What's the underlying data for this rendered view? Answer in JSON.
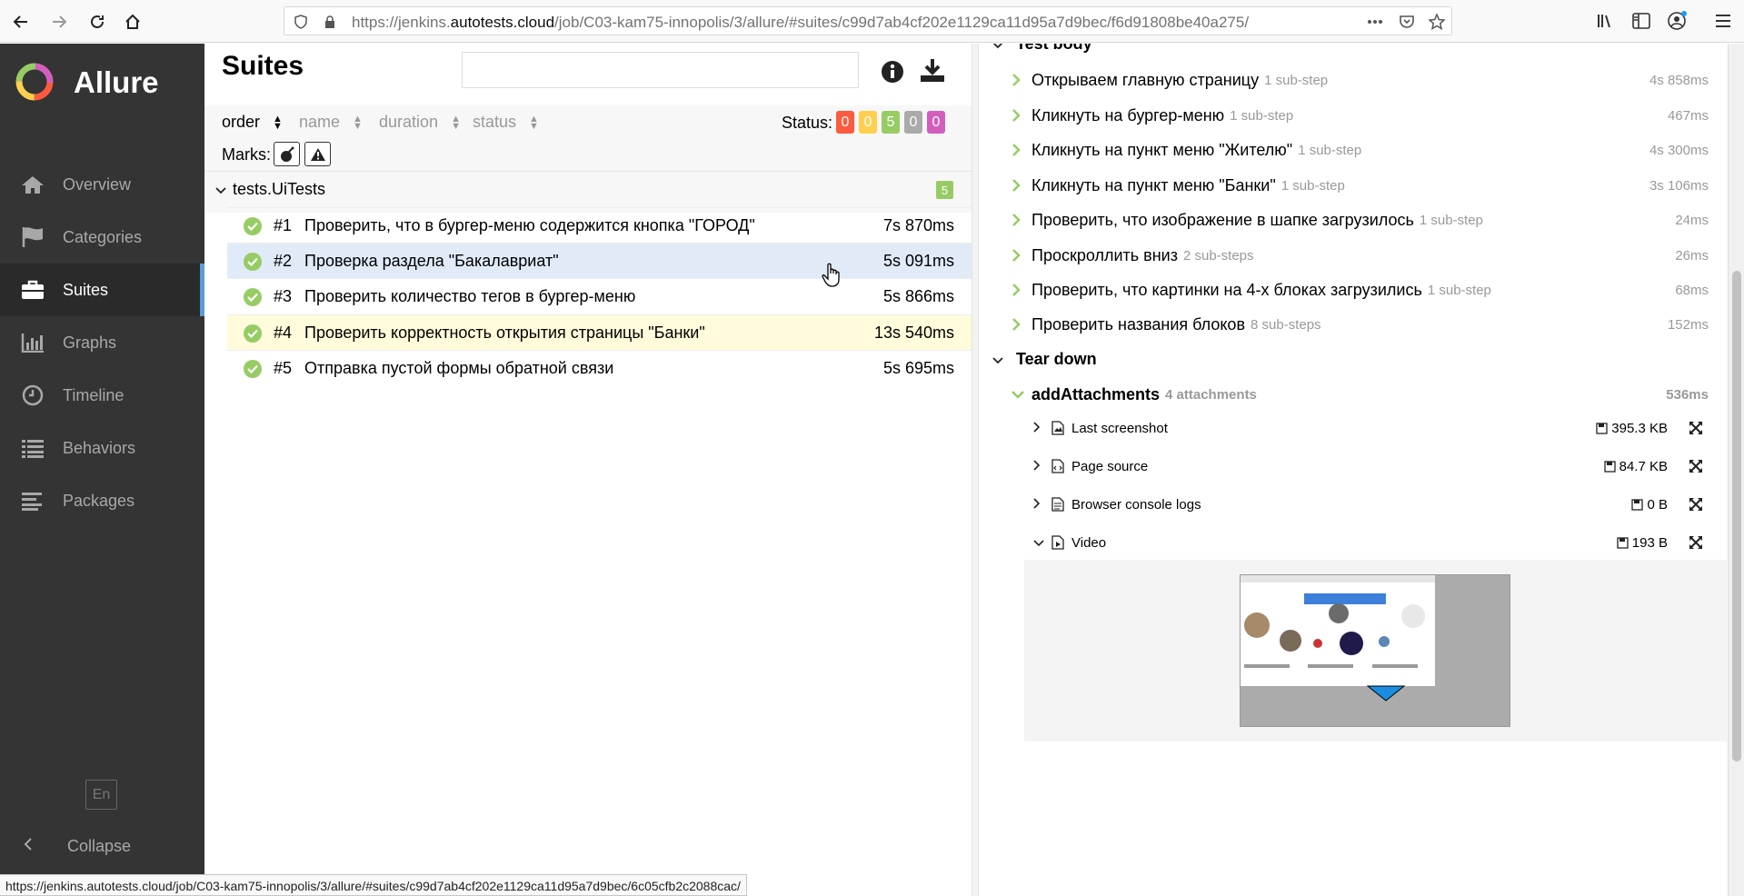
{
  "browser": {
    "url_prefix": "https://jenkins.",
    "url_host": "autotests.cloud",
    "url_path": "/job/C03-kam75-innopolis/3/allure/#suites/c99d7ab4cf202e1129ca11d95a7d9bec/f6d91808be40a275/",
    "icons": [
      "back-icon",
      "forward-icon",
      "reload-icon",
      "home-icon",
      "shield-icon",
      "lock-icon",
      "more-icon",
      "pocket-icon",
      "star-icon",
      "library-icon",
      "sidebar-icon",
      "account-icon",
      "menu-icon"
    ]
  },
  "sidebar": {
    "brand": "Allure",
    "items": [
      {
        "label": "Overview",
        "icon": "home-icon"
      },
      {
        "label": "Categories",
        "icon": "flag-icon"
      },
      {
        "label": "Suites",
        "icon": "briefcase-icon"
      },
      {
        "label": "Graphs",
        "icon": "bar-chart-icon"
      },
      {
        "label": "Timeline",
        "icon": "clock-icon"
      },
      {
        "label": "Behaviors",
        "icon": "list-icon"
      },
      {
        "label": "Packages",
        "icon": "align-left-icon"
      }
    ],
    "lang": "En",
    "collapse": "Collapse"
  },
  "suites": {
    "title": "Suites",
    "search_placeholder": "",
    "sort": {
      "order": "order",
      "name": "name",
      "duration": "duration",
      "status": "status"
    },
    "status_label": "Status:",
    "status_counts": [
      {
        "value": "0",
        "color": "#fd5a3e"
      },
      {
        "value": "0",
        "color": "#ffd050"
      },
      {
        "value": "5",
        "color": "#97cc64"
      },
      {
        "value": "0",
        "color": "#aaaaaa"
      },
      {
        "value": "0",
        "color": "#d35ebe"
      }
    ],
    "marks_label": "Marks:",
    "group": {
      "title": "tests.UiTests",
      "count": "5"
    },
    "tests": [
      {
        "num": "#1",
        "name": "Проверить, что в бургер-меню содержится кнопка \"ГОРОД\"",
        "duration": "7s 870ms"
      },
      {
        "num": "#2",
        "name": "Проверка раздела \"Бакалавриат\"",
        "duration": "5s 091ms"
      },
      {
        "num": "#3",
        "name": "Проверить количество тегов в бургер-меню",
        "duration": "5s 866ms"
      },
      {
        "num": "#4",
        "name": "Проверить корректность открытия страницы \"Банки\"",
        "duration": "13s 540ms"
      },
      {
        "num": "#5",
        "name": "Отправка пустой формы обратной связи",
        "duration": "5s 695ms"
      }
    ]
  },
  "details": {
    "test_body_label": "Test body",
    "steps": [
      {
        "name": "Открываем главную страницу",
        "sub": "1 sub-step",
        "duration": "4s 858ms"
      },
      {
        "name": "Кликнуть на бургер-меню",
        "sub": "1 sub-step",
        "duration": "467ms"
      },
      {
        "name": "Кликнуть на пункт меню \"Жителю\"",
        "sub": "1 sub-step",
        "duration": "4s 300ms"
      },
      {
        "name": "Кликнуть на пункт меню \"Банки\"",
        "sub": "1 sub-step",
        "duration": "3s 106ms"
      },
      {
        "name": "Проверить, что изображение в шапке загрузилось",
        "sub": "1 sub-step",
        "duration": "24ms"
      },
      {
        "name": "Проскроллить вниз",
        "sub": "2 sub-steps",
        "duration": "26ms"
      },
      {
        "name": "Проверить, что картинки на 4-х блоках загрузились",
        "sub": "1 sub-step",
        "duration": "68ms"
      },
      {
        "name": "Проверить названия блоков",
        "sub": "8 sub-steps",
        "duration": "152ms"
      }
    ],
    "tear_down_label": "Tear down",
    "tear_step": {
      "name": "addAttachments",
      "sub": "4 attachments",
      "duration": "536ms"
    },
    "attachments": [
      {
        "name": "Last screenshot",
        "size": "395.3 KB"
      },
      {
        "name": "Page source",
        "size": "84.7 KB"
      },
      {
        "name": "Browser console logs",
        "size": "0 B"
      },
      {
        "name": "Video",
        "size": "193 B"
      }
    ]
  },
  "statusbar": "https://jenkins.autotests.cloud/job/C03-kam75-innopolis/3/allure/#suites/c99d7ab4cf202e1129ca11d95a7d9bec/6c05cfb2c2088cac/"
}
